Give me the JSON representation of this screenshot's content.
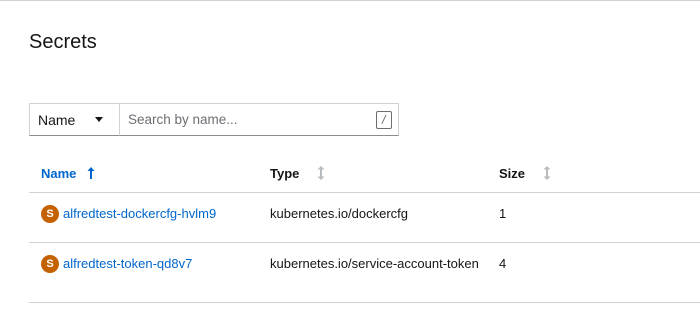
{
  "page": {
    "title": "Secrets"
  },
  "filter": {
    "selected": "Name",
    "search_placeholder": "Search by name...",
    "search_value": "",
    "shortcut_key": "/"
  },
  "table": {
    "columns": [
      {
        "label": "Name",
        "sort": "ascending",
        "active": true
      },
      {
        "label": "Type",
        "sort": "none",
        "active": false
      },
      {
        "label": "Size",
        "sort": "none",
        "active": false
      }
    ],
    "rows": [
      {
        "badge": "S",
        "name": "alfredtest-dockercfg-hvlm9",
        "type": "kubernetes.io/dockercfg",
        "size": "1"
      },
      {
        "badge": "S",
        "name": "alfredtest-token-qd8v7",
        "type": "kubernetes.io/service-account-token",
        "size": "4"
      }
    ]
  },
  "colors": {
    "link": "#0066cc",
    "secret_badge": "#c46100",
    "border": "#d2d2d2"
  },
  "icons": {
    "sort_active": "arrow-up-icon",
    "sort_inactive": "sort-both-icon",
    "dropdown": "caret-down-icon"
  }
}
